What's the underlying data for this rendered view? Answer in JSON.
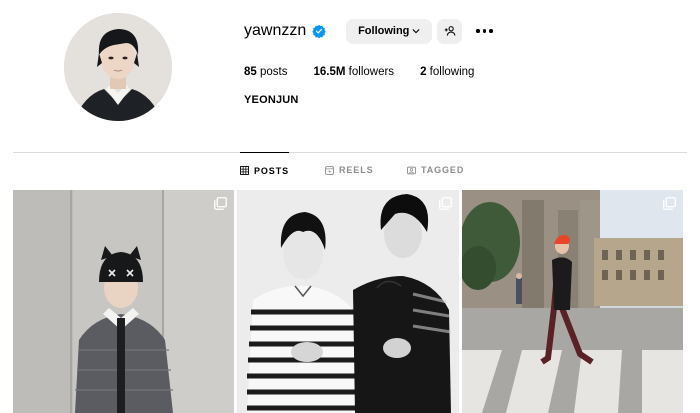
{
  "profile": {
    "username": "yawnzzn",
    "verified": true,
    "follow_button_label": "Following",
    "posts_count": "85",
    "posts_label": "posts",
    "followers_count": "16.5M",
    "followers_label": "followers",
    "following_count": "2",
    "following_label": "following",
    "full_name": "YEONJUN"
  },
  "tabs": [
    {
      "label": "POSTS",
      "icon": "grid-icon",
      "active": true
    },
    {
      "label": "REELS",
      "icon": "reels-icon",
      "active": false
    },
    {
      "label": "TAGGED",
      "icon": "tagged-icon",
      "active": false
    }
  ],
  "posts": [
    {
      "type": "carousel",
      "description": "person in black cat-ear beanie and grey knit"
    },
    {
      "type": "carousel",
      "description": "two people black and white photo"
    },
    {
      "type": "carousel",
      "description": "person with red hair crossing street"
    }
  ],
  "colors": {
    "verified": "#0095f6",
    "button_bg": "#efefef",
    "divider": "#dbdbdb",
    "muted_text": "#8e8e8e"
  }
}
